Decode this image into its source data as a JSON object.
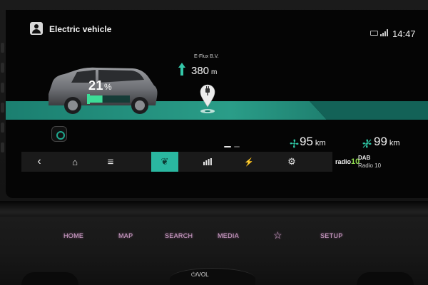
{
  "header": {
    "title": "Electric vehicle",
    "clock": "14:47",
    "profile_icon": "user-profile-icon",
    "status_icon": "phone-status-icon",
    "signal_icon": "signal-bars-icon"
  },
  "navigation": {
    "destination_name": "E-Flux B.V.",
    "distance_value": "380",
    "distance_unit": "m",
    "arrow_icon": "straight-arrow-icon",
    "pin_icon": "charging-station-pin-icon"
  },
  "vehicle": {
    "battery_value": "21",
    "battery_unit": "%",
    "battery_level": 0.21,
    "charge_color": "#3ddc97"
  },
  "range": {
    "climate_off_value": "95",
    "climate_off_unit": "km",
    "climate_on_value": "99",
    "climate_on_unit": "km"
  },
  "nav_bar": {
    "items": [
      {
        "name": "back",
        "glyph": "‹",
        "icon": "back-chevron-icon"
      },
      {
        "name": "home",
        "glyph": "⌂",
        "icon": "home-icon"
      },
      {
        "name": "menu",
        "glyph": "≡",
        "icon": "menu-icon"
      },
      {
        "name": "eco",
        "glyph": "❦",
        "icon": "leaf-icon",
        "active": true
      },
      {
        "name": "stats",
        "glyph": "▮",
        "icon": "bar-chart-icon"
      },
      {
        "name": "charging",
        "glyph": "⚡",
        "icon": "charging-plug-icon"
      },
      {
        "name": "settings",
        "glyph": "⚙",
        "icon": "gear-icon"
      }
    ]
  },
  "radio": {
    "logo_text": "radio",
    "logo_number": "10",
    "band": "DAB",
    "station": "Radio 10"
  },
  "hardware_buttons": {
    "home": "HOME",
    "map": "MAP",
    "search": "SEARCH",
    "media": "MEDIA",
    "favorite": "☆",
    "setup": "SETUP",
    "volume": "⏻/VOL"
  },
  "colors": {
    "accent_teal": "#2ab7a0",
    "road_teal": "#1f8a78",
    "button_glow": "#d9a8d2"
  }
}
